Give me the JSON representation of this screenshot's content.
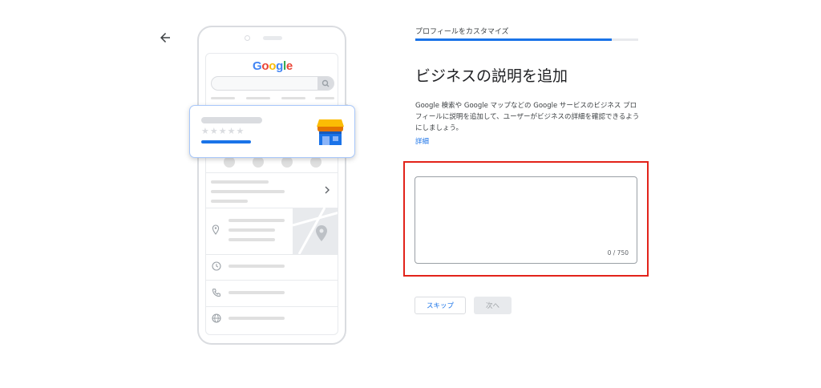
{
  "header": {
    "step_label": "プロフィールをカスタマイズ",
    "progress_fraction": 0.88
  },
  "main": {
    "title": "ビジネスの説明を追加",
    "description": "Google 検索や Google マップなどの Google サービスのビジネス プロフィールに説明を追加して、ユーザーがビジネスの詳細を確認できるようにしましょう。",
    "learn_more": "詳細",
    "textarea": {
      "value": "",
      "char_count": "0 / 750"
    }
  },
  "actions": {
    "skip_label": "スキップ",
    "next_label": "次へ"
  },
  "illustration": {
    "logo_letters": [
      "G",
      "o",
      "o",
      "g",
      "l",
      "e"
    ],
    "logo_colors": [
      "#4285F4",
      "#EA4335",
      "#FBBC05",
      "#4285F4",
      "#34A853",
      "#EA4335"
    ],
    "stars": "★★★★★"
  },
  "colors": {
    "accent": "#1a73e8",
    "highlight": "#e2231a"
  },
  "icons": {
    "back": "arrow-back-icon",
    "search": "search-icon",
    "store": "storefront-icon",
    "location": "location-pin-icon",
    "clock": "clock-icon",
    "phone": "phone-icon",
    "globe": "globe-icon",
    "chevron": "chevron-right-icon"
  }
}
